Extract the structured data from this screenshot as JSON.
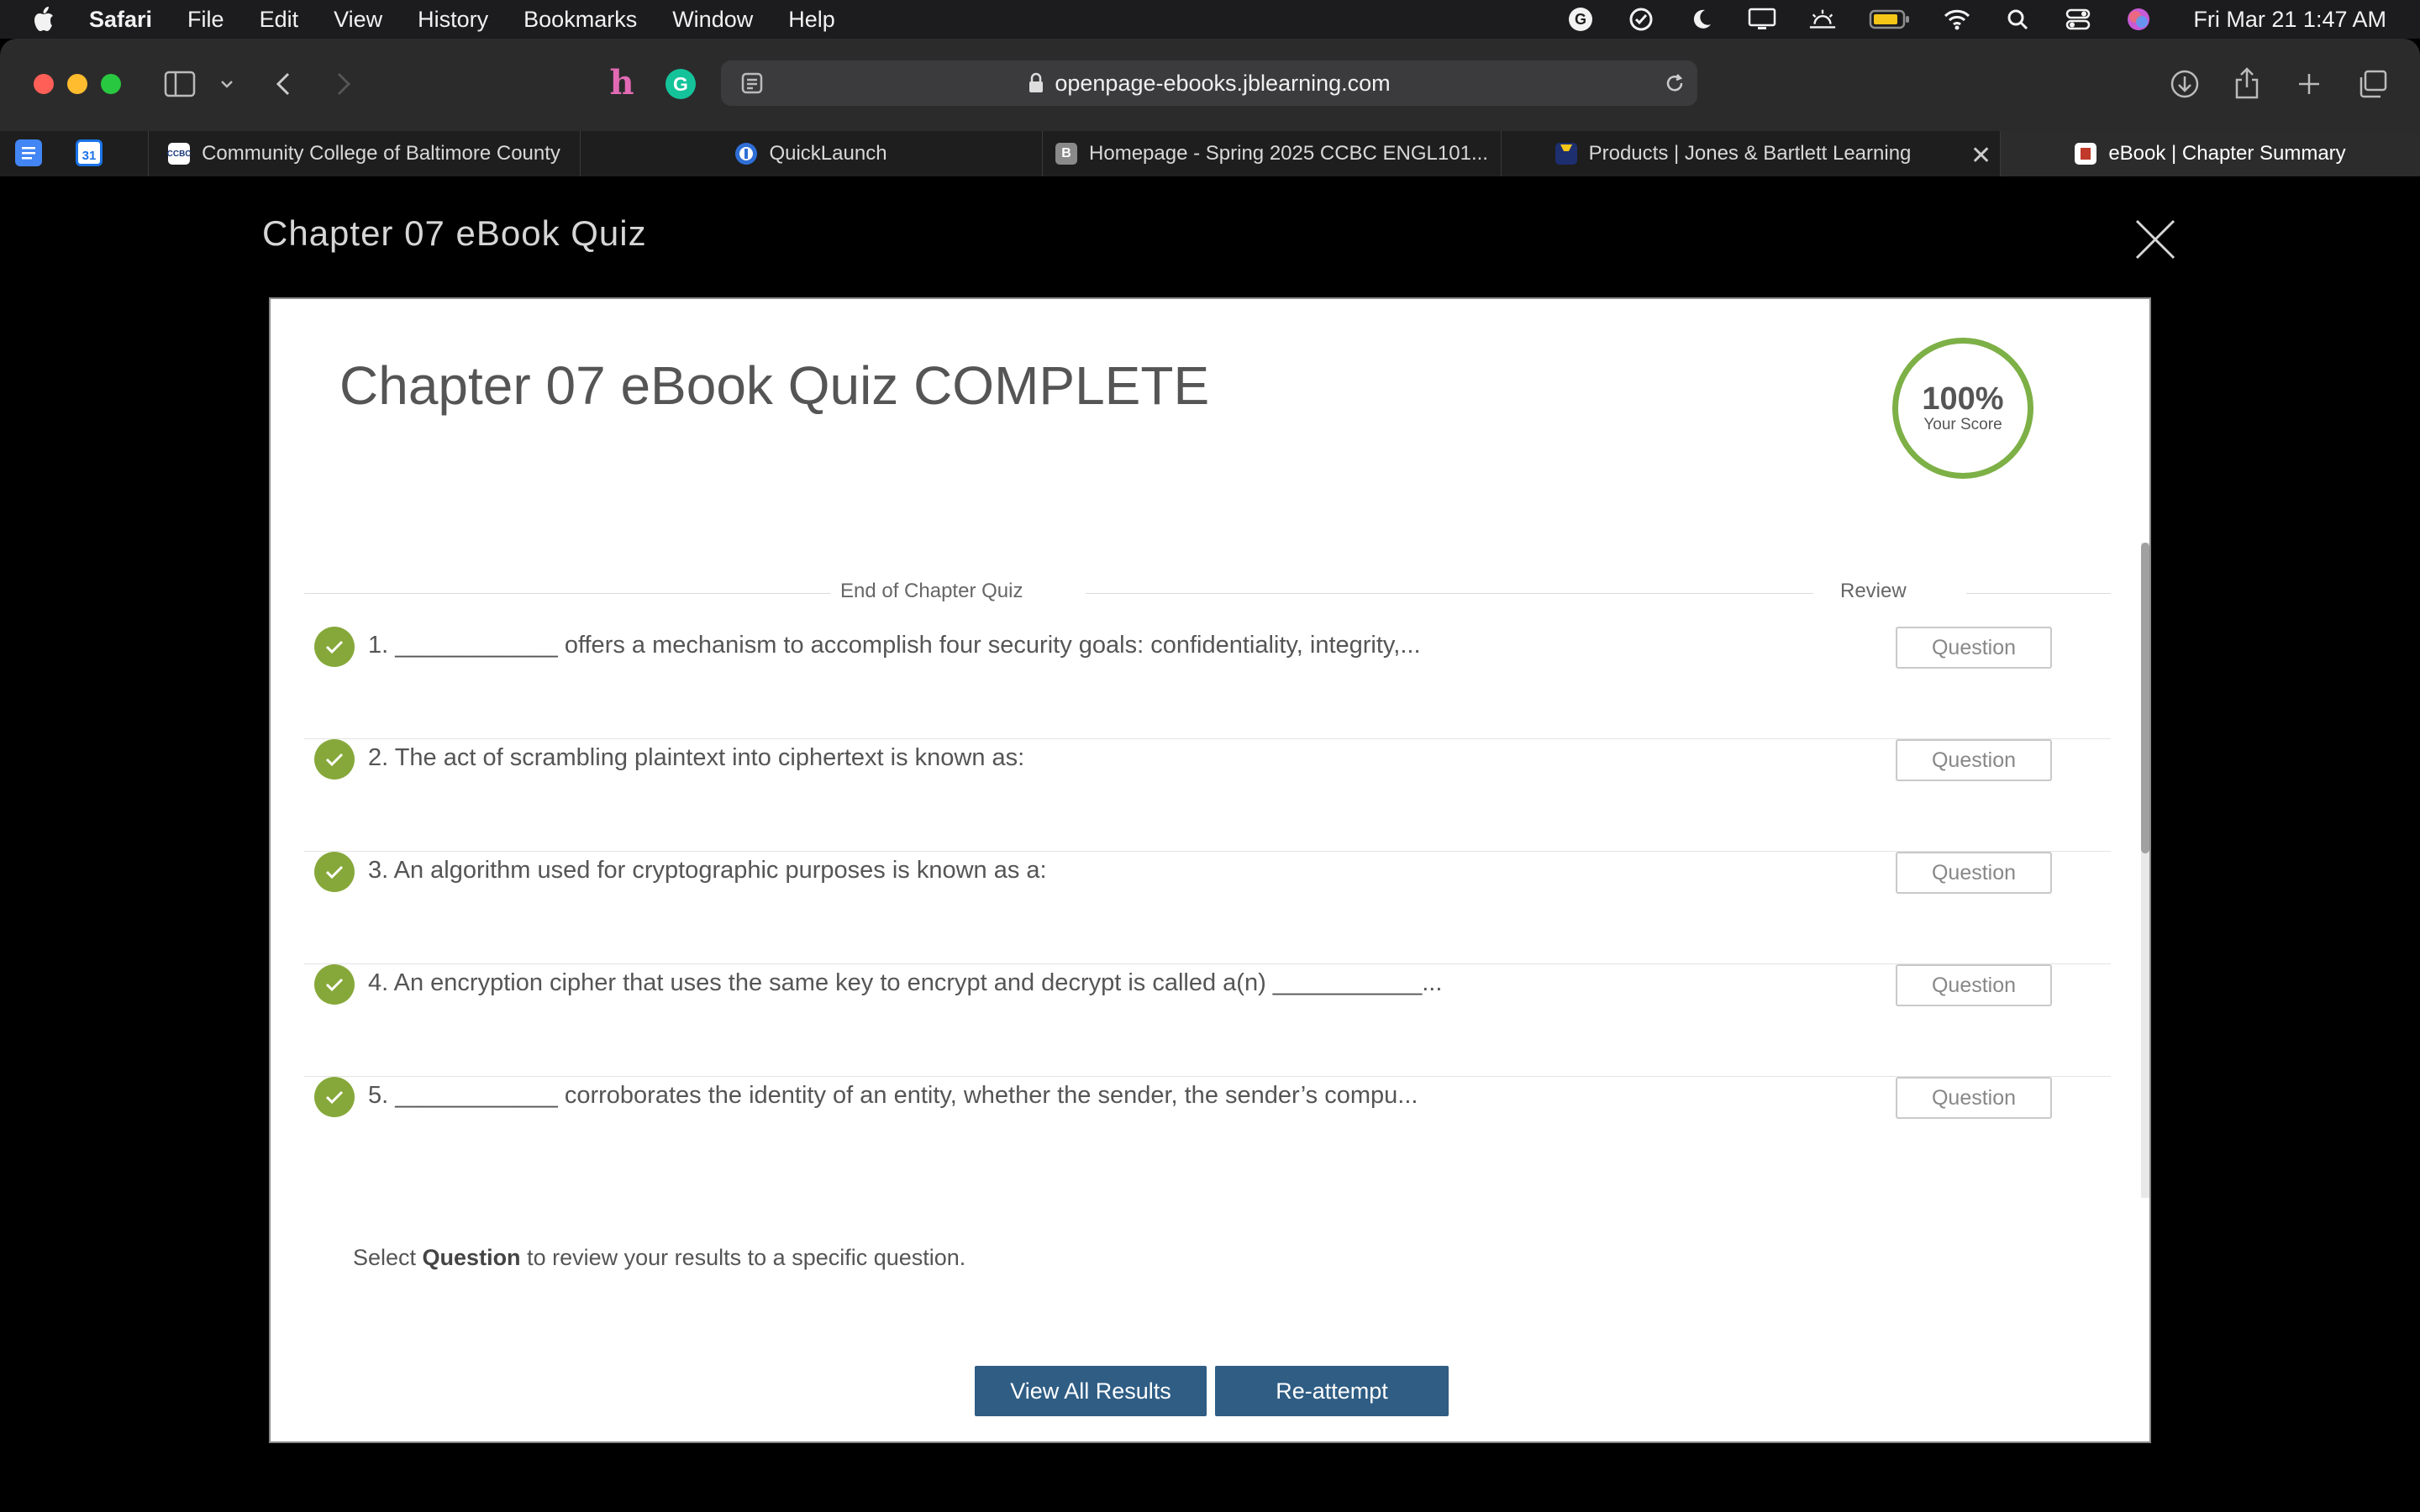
{
  "menubar": {
    "app_name": "Safari",
    "items": [
      "File",
      "Edit",
      "View",
      "History",
      "Bookmarks",
      "Window",
      "Help"
    ],
    "clock": "Fri Mar 21  1:47 AM"
  },
  "toolbar": {
    "url": "openpage-ebooks.jblearning.com"
  },
  "tabs": [
    {
      "title": "Community College of Baltimore County",
      "icon": "ccbc-favicon"
    },
    {
      "title": "QuickLaunch",
      "icon": "quicklaunch-favicon"
    },
    {
      "title": "Homepage - Spring 2025 CCBC ENGL101...",
      "icon": "b-favicon",
      "icon_letter": "B"
    },
    {
      "title": "Products | Jones & Bartlett Learning",
      "icon": "jb-favicon"
    },
    {
      "title": "eBook | Chapter Summary",
      "icon": "ebook-favicon",
      "active": true
    }
  ],
  "modal": {
    "title": "Chapter 07 eBook Quiz",
    "quiz_title": "Chapter 07 eBook Quiz COMPLETE",
    "score": {
      "value": "100%",
      "label": "Your Score"
    },
    "columns": {
      "quiz": "End of Chapter Quiz",
      "review": "Review"
    },
    "questions": [
      {
        "text": "1. ____________ offers a mechanism to accomplish four security goals: confidentiality, integrity,...",
        "button": "Question",
        "correct": true
      },
      {
        "text": "2. The act of scrambling plaintext into ciphertext is known as:",
        "button": "Question",
        "correct": true
      },
      {
        "text": "3. An algorithm used for cryptographic purposes is known as a:",
        "button": "Question",
        "correct": true
      },
      {
        "text": "4. An encryption cipher that uses the same key to encrypt and decrypt is called a(n) ___________...",
        "button": "Question",
        "correct": true
      },
      {
        "text": "5. ____________ corroborates the identity of an entity, whether the sender, the sender’s compu...",
        "button": "Question",
        "correct": true
      }
    ],
    "hint": {
      "prefix": "Select ",
      "bold": "Question",
      "suffix": " to review your results to a specific question."
    },
    "buttons": {
      "view_all": "View All Results",
      "reattempt": "Re-attempt"
    }
  },
  "colors": {
    "accent_button": "#2f5d84",
    "check_green": "#86a83a",
    "score_ring": "#7db046"
  }
}
